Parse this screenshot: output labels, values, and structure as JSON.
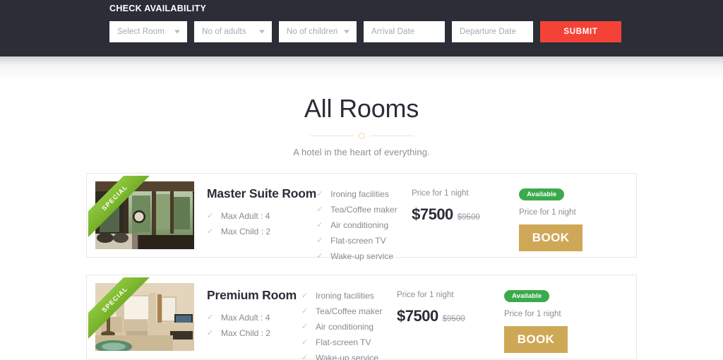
{
  "availability": {
    "title": "CHECK AVAILABILITY",
    "fields": [
      {
        "name": "select-room",
        "placeholder": "Select Room",
        "type": "select"
      },
      {
        "name": "no-of-adults",
        "placeholder": "No of adults",
        "type": "select"
      },
      {
        "name": "no-of-children",
        "placeholder": "No of children",
        "type": "select"
      },
      {
        "name": "arrival-date",
        "placeholder": "Arrival Date",
        "type": "date"
      },
      {
        "name": "departure-date",
        "placeholder": "Departure Date",
        "type": "date"
      }
    ],
    "submit_label": "SUBMIT",
    "submit_color": "#f44336"
  },
  "heading": {
    "title": "All Rooms",
    "subtitle": "A hotel in the heart of everything.",
    "divider_color": "#f6e2cc"
  },
  "rooms": [
    {
      "name": "Master Suite Room",
      "ribbon": "SPECIAL",
      "ribbon_color": "#8dc63f",
      "specs": [
        "Max Adult : 4",
        "Max Child : 2"
      ],
      "amenities": [
        "Ironing facilities",
        "Tea/Coffee maker",
        "Air conditioning",
        "Flat-screen TV",
        "Wake-up service"
      ],
      "price_label": "Price for 1 night",
      "price_current": "$7500",
      "price_old": "$9500",
      "status": "Available",
      "status_color": "#3aaa4a",
      "booking_label": "Price for 1 night",
      "book_label": "BOOK",
      "book_color": "#cfa857",
      "thumb": "master-suite-interior-photo"
    },
    {
      "name": "Premium Room",
      "ribbon": "SPECIAL",
      "ribbon_color": "#8dc63f",
      "specs": [
        "Max Adult : 4",
        "Max Child : 2"
      ],
      "amenities": [
        "Ironing facilities",
        "Tea/Coffee maker",
        "Air conditioning",
        "Flat-screen TV",
        "Wake-up service"
      ],
      "price_label": "Price for 1 night",
      "price_current": "$7500",
      "price_old": "$9500",
      "status": "Available",
      "status_color": "#3aaa4a",
      "booking_label": "Price for 1 night",
      "book_label": "BOOK",
      "book_color": "#cfa857",
      "thumb": "premium-room-living-area-photo"
    }
  ],
  "icons": {
    "check": "✓",
    "caret_down": "caret-down-icon"
  }
}
